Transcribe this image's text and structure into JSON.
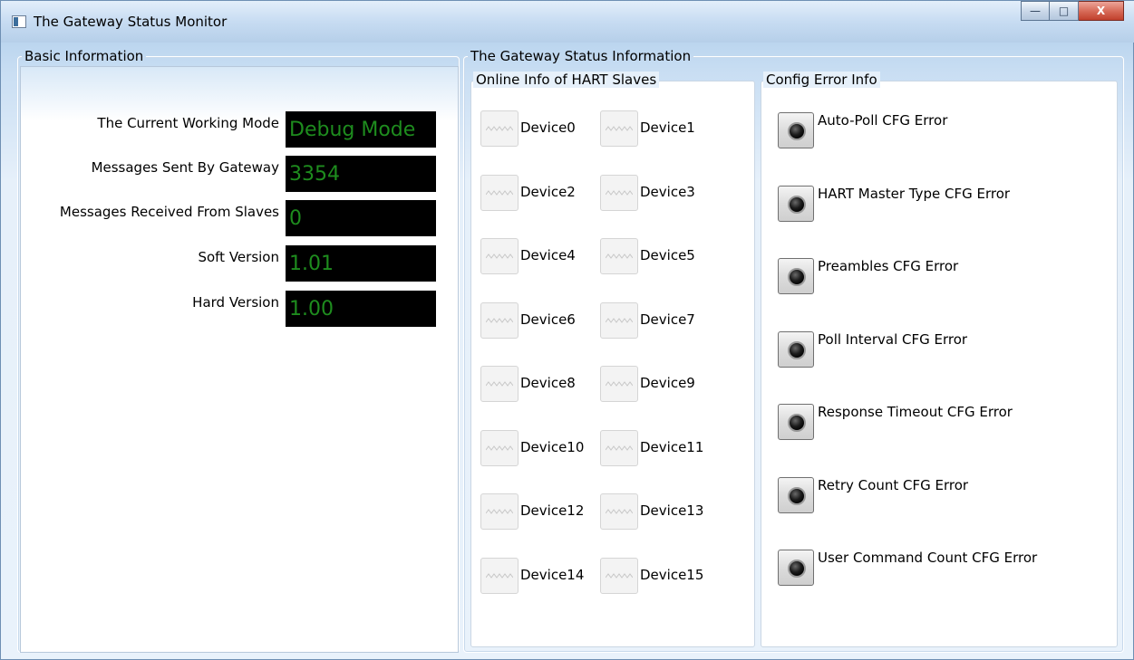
{
  "window": {
    "title": "The Gateway Status Monitor",
    "buttons": {
      "minimize": "—",
      "maximize": "□",
      "close": "X"
    }
  },
  "basic": {
    "legend": "Basic Information",
    "rows": [
      {
        "label": "The Current Working Mode",
        "value": "Debug Mode"
      },
      {
        "label": "Messages Sent By Gateway",
        "value": "3354"
      },
      {
        "label": "Messages Received From Slaves",
        "value": "0"
      },
      {
        "label": "Soft Version",
        "value": "1.01"
      },
      {
        "label": "Hard Version",
        "value": "1.00"
      }
    ]
  },
  "status": {
    "legend": "The Gateway Status Information",
    "online": {
      "legend": "Online Info of HART Slaves",
      "devices": [
        "Device0",
        "Device1",
        "Device2",
        "Device3",
        "Device4",
        "Device5",
        "Device6",
        "Device7",
        "Device8",
        "Device9",
        "Device10",
        "Device11",
        "Device12",
        "Device13",
        "Device14",
        "Device15"
      ]
    },
    "config": {
      "legend": "Config Error Info",
      "errors": [
        "Auto-Poll CFG Error",
        "HART Master Type CFG Error",
        "Preambles CFG Error",
        "Poll Interval CFG Error",
        "Response Timeout CFG Error",
        "Retry Count CFG Error",
        "User Command Count CFG Error"
      ]
    }
  }
}
